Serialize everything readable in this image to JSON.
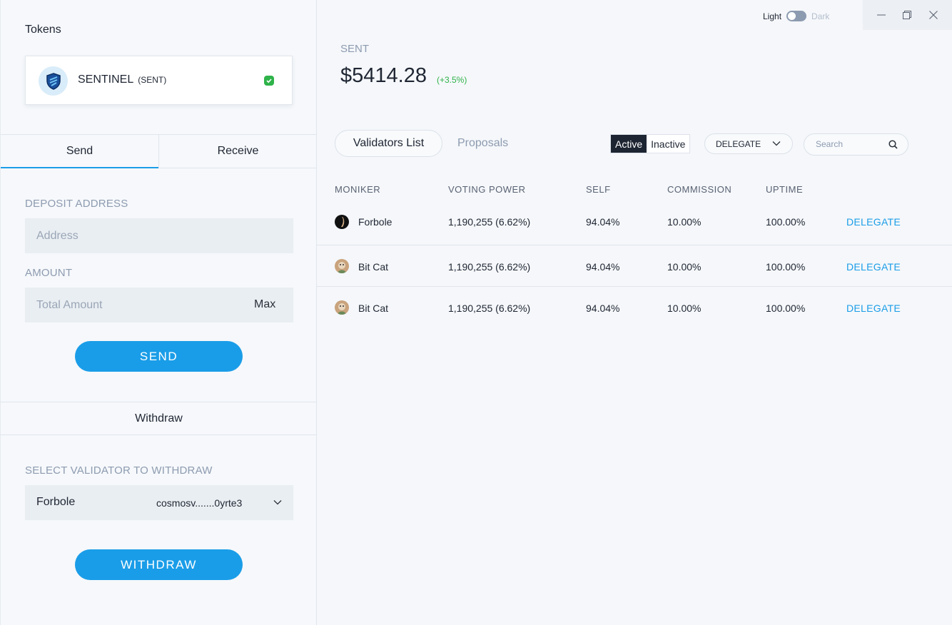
{
  "left": {
    "tokens_title": "Tokens",
    "token": {
      "name": "SENTINEL",
      "symbol": "(SENT)"
    },
    "tabs": [
      {
        "label": "Send"
      },
      {
        "label": "Receive"
      }
    ],
    "deposit_label": "DEPOSIT ADDRESS",
    "address_placeholder": "Address",
    "amount_label": "AMOUNT",
    "amount_placeholder": "Total Amount",
    "max_label": "Max",
    "send_label": "SEND",
    "withdraw_title": "Withdraw",
    "select_validator_label": "SELECT VALIDATOR TO WITHDRAW",
    "selected_validator": {
      "name": "Forbole",
      "address": "cosmosv.......0yrte3"
    },
    "withdraw_label": "WITHDRAW"
  },
  "right": {
    "theme": {
      "light": "Light",
      "dark": "Dark"
    },
    "coin_symbol": "SENT",
    "price": "$5414.28",
    "change": "(+3.5%)",
    "tabs": {
      "validators": "Validators List",
      "proposals": "Proposals"
    },
    "filter": {
      "active": "Active",
      "inactive": "Inactive"
    },
    "dropdown": "DELEGATE",
    "search_placeholder": "Search",
    "columns": [
      "MONIKER",
      "VOTING POWER",
      "SELF",
      "COMMISSION",
      "UPTIME"
    ],
    "rows": [
      {
        "moniker": "Forbole",
        "voting_power": "1,190,255 (6.62%)",
        "self": "94.04%",
        "commission": "10.00%",
        "uptime": "100.00%",
        "action": "DELEGATE"
      },
      {
        "moniker": "Bit Cat",
        "voting_power": "1,190,255 (6.62%)",
        "self": "94.04%",
        "commission": "10.00%",
        "uptime": "100.00%",
        "action": "DELEGATE"
      },
      {
        "moniker": "Bit Cat",
        "voting_power": "1,190,255 (6.62%)",
        "self": "94.04%",
        "commission": "10.00%",
        "uptime": "100.00%",
        "action": "DELEGATE"
      }
    ]
  },
  "colors": {
    "accent": "#1a9de8",
    "positive": "#2fb34a",
    "dark": "#1e2532",
    "muted": "#8d9bb0"
  },
  "icons": [
    "shield-icon",
    "check-icon",
    "chevron-down-icon",
    "search-icon",
    "minimize-icon",
    "restore-icon",
    "close-icon"
  ]
}
